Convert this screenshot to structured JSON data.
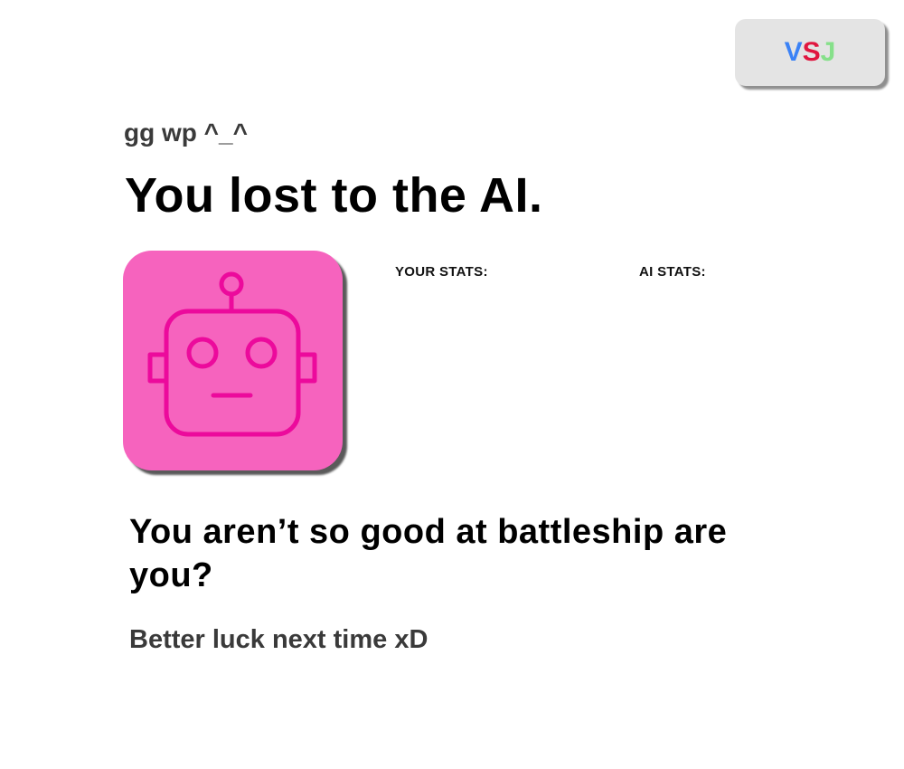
{
  "header": {
    "brand": {
      "letters": [
        {
          "char": "V",
          "color": "#3b82f6"
        },
        {
          "char": "S",
          "color": "#e0163f"
        },
        {
          "char": "J",
          "color": "#86e08a"
        }
      ]
    }
  },
  "result": {
    "eyebrow": "gg wp ^_^",
    "title": "You lost to the AI.",
    "avatar_icon": "robot-icon",
    "avatar_color": "#f663be",
    "avatar_stroke": "#ec0a9c"
  },
  "stats": {
    "user_label": "YOUR STATS:",
    "ai_label": "AI STATS:"
  },
  "message": {
    "taunt": "You aren’t so good at battleship are you?",
    "luck": "Better luck next time xD"
  }
}
